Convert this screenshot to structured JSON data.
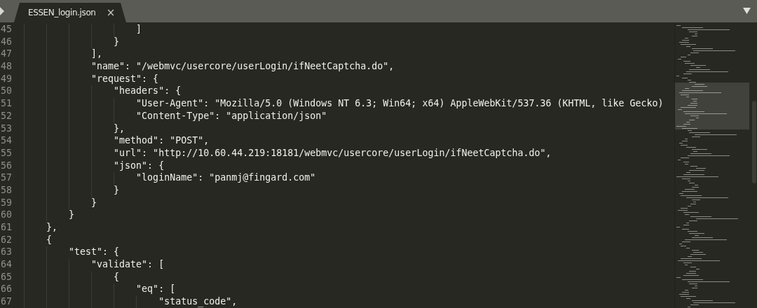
{
  "tabs": [
    {
      "label": "ESSEN_login.json",
      "close": "×",
      "selected": true
    }
  ],
  "editor": {
    "lines": [
      {
        "number": "45",
        "text": "                    ]"
      },
      {
        "number": "46",
        "text": "                }"
      },
      {
        "number": "47",
        "text": "            ],"
      },
      {
        "number": "48",
        "text": "            \"name\": \"/webmvc/usercore/userLogin/ifNeetCaptcha.do\","
      },
      {
        "number": "49",
        "text": "            \"request\": {"
      },
      {
        "number": "50",
        "text": "                \"headers\": {"
      },
      {
        "number": "51",
        "text": "                    \"User-Agent\": \"Mozilla/5.0 (Windows NT 6.3; Win64; x64) AppleWebKit/537.36 (KHTML, like Gecko)"
      },
      {
        "number": "52",
        "text": "                    \"Content-Type\": \"application/json\""
      },
      {
        "number": "53",
        "text": "                },"
      },
      {
        "number": "54",
        "text": "                \"method\": \"POST\","
      },
      {
        "number": "55",
        "text": "                \"url\": \"http://10.60.44.219:18181/webmvc/usercore/userLogin/ifNeetCaptcha.do\","
      },
      {
        "number": "56",
        "text": "                \"json\": {"
      },
      {
        "number": "57",
        "text": "                    \"loginName\": \"panmj@fingard.com\""
      },
      {
        "number": "58",
        "text": "                }"
      },
      {
        "number": "59",
        "text": "            }"
      },
      {
        "number": "60",
        "text": "        }"
      },
      {
        "number": "61",
        "text": "    },"
      },
      {
        "number": "62",
        "text": "    {"
      },
      {
        "number": "63",
        "text": "        \"test\": {"
      },
      {
        "number": "64",
        "text": "            \"validate\": ["
      },
      {
        "number": "65",
        "text": "                {"
      },
      {
        "number": "66",
        "text": "                    \"eq\": ["
      },
      {
        "number": "67",
        "text": "                        \"status_code\","
      }
    ]
  }
}
